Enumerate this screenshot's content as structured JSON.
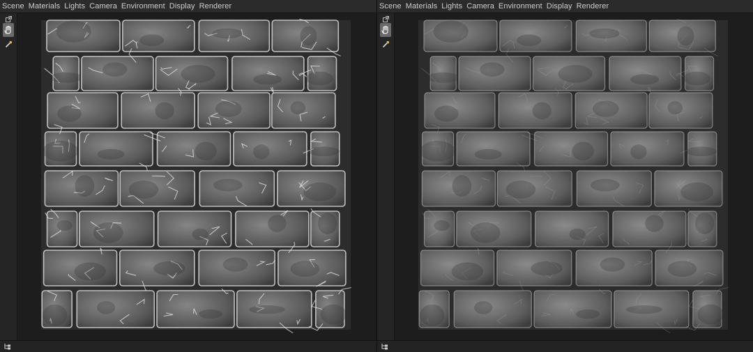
{
  "viewports": [
    {
      "menu": [
        "Scene",
        "Materials",
        "Lights",
        "Camera",
        "Environment",
        "Display",
        "Renderer"
      ],
      "tools": [
        "popout-icon",
        "hand-icon",
        "eyedropper-icon"
      ],
      "status_icon": "tree-icon",
      "texture": "stone-wall-edges-highlighted"
    },
    {
      "menu": [
        "Scene",
        "Materials",
        "Lights",
        "Camera",
        "Environment",
        "Display",
        "Renderer"
      ],
      "tools": [
        "popout-icon",
        "hand-icon",
        "eyedropper-icon"
      ],
      "status_icon": "tree-icon",
      "texture": "stone-wall-soft"
    }
  ],
  "colors": {
    "menubar": "#2b2b2b",
    "background": "#1c1c1c",
    "stone": "#6e6e6e",
    "mortar": "#2a2a2a",
    "highlight": "#dcdcdc"
  }
}
